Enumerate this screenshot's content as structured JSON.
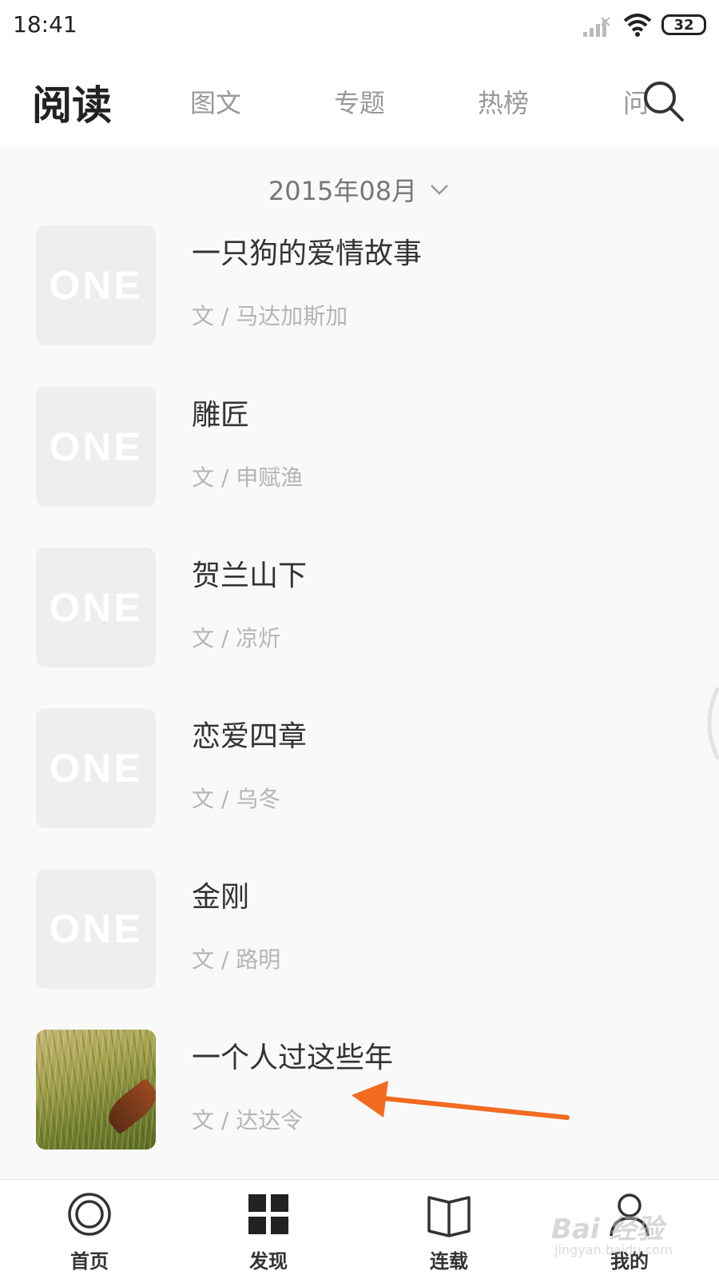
{
  "status_bar": {
    "time": "18:41",
    "battery": "32",
    "icons": [
      "signal-icon",
      "wifi-icon",
      "battery-icon"
    ]
  },
  "header": {
    "title": "阅读",
    "tabs": [
      {
        "label": "图文"
      },
      {
        "label": "专题"
      },
      {
        "label": "热榜"
      },
      {
        "label": "问"
      }
    ],
    "search_icon": "search-icon"
  },
  "month_selector": {
    "label": "2015年08月",
    "icon": "chevron-down-icon"
  },
  "articles": [
    {
      "title": "一只狗的爱情故事",
      "author": "文 / 马达加斯加",
      "thumb": "ONE"
    },
    {
      "title": "雕匠",
      "author": "文 / 申赋渔",
      "thumb": "ONE"
    },
    {
      "title": "贺兰山下",
      "author": "文 / 凉炘",
      "thumb": "ONE"
    },
    {
      "title": "恋爱四章",
      "author": "文 / 乌冬",
      "thumb": "ONE"
    },
    {
      "title": "金刚",
      "author": "文 / 路明",
      "thumb": "ONE"
    },
    {
      "title": "一个人过这些年",
      "author": "文 / 达达令",
      "thumb": "photo"
    }
  ],
  "annotation": {
    "arrow_color": "#f26b21"
  },
  "bottom_nav": [
    {
      "label": "首页",
      "icon": "home-circle-icon"
    },
    {
      "label": "发现",
      "icon": "grid-icon"
    },
    {
      "label": "连载",
      "icon": "book-icon"
    },
    {
      "label": "我的",
      "icon": "user-icon"
    }
  ],
  "watermark": {
    "main": "Bai 经验",
    "sub": "jingyan.baidu.com"
  }
}
